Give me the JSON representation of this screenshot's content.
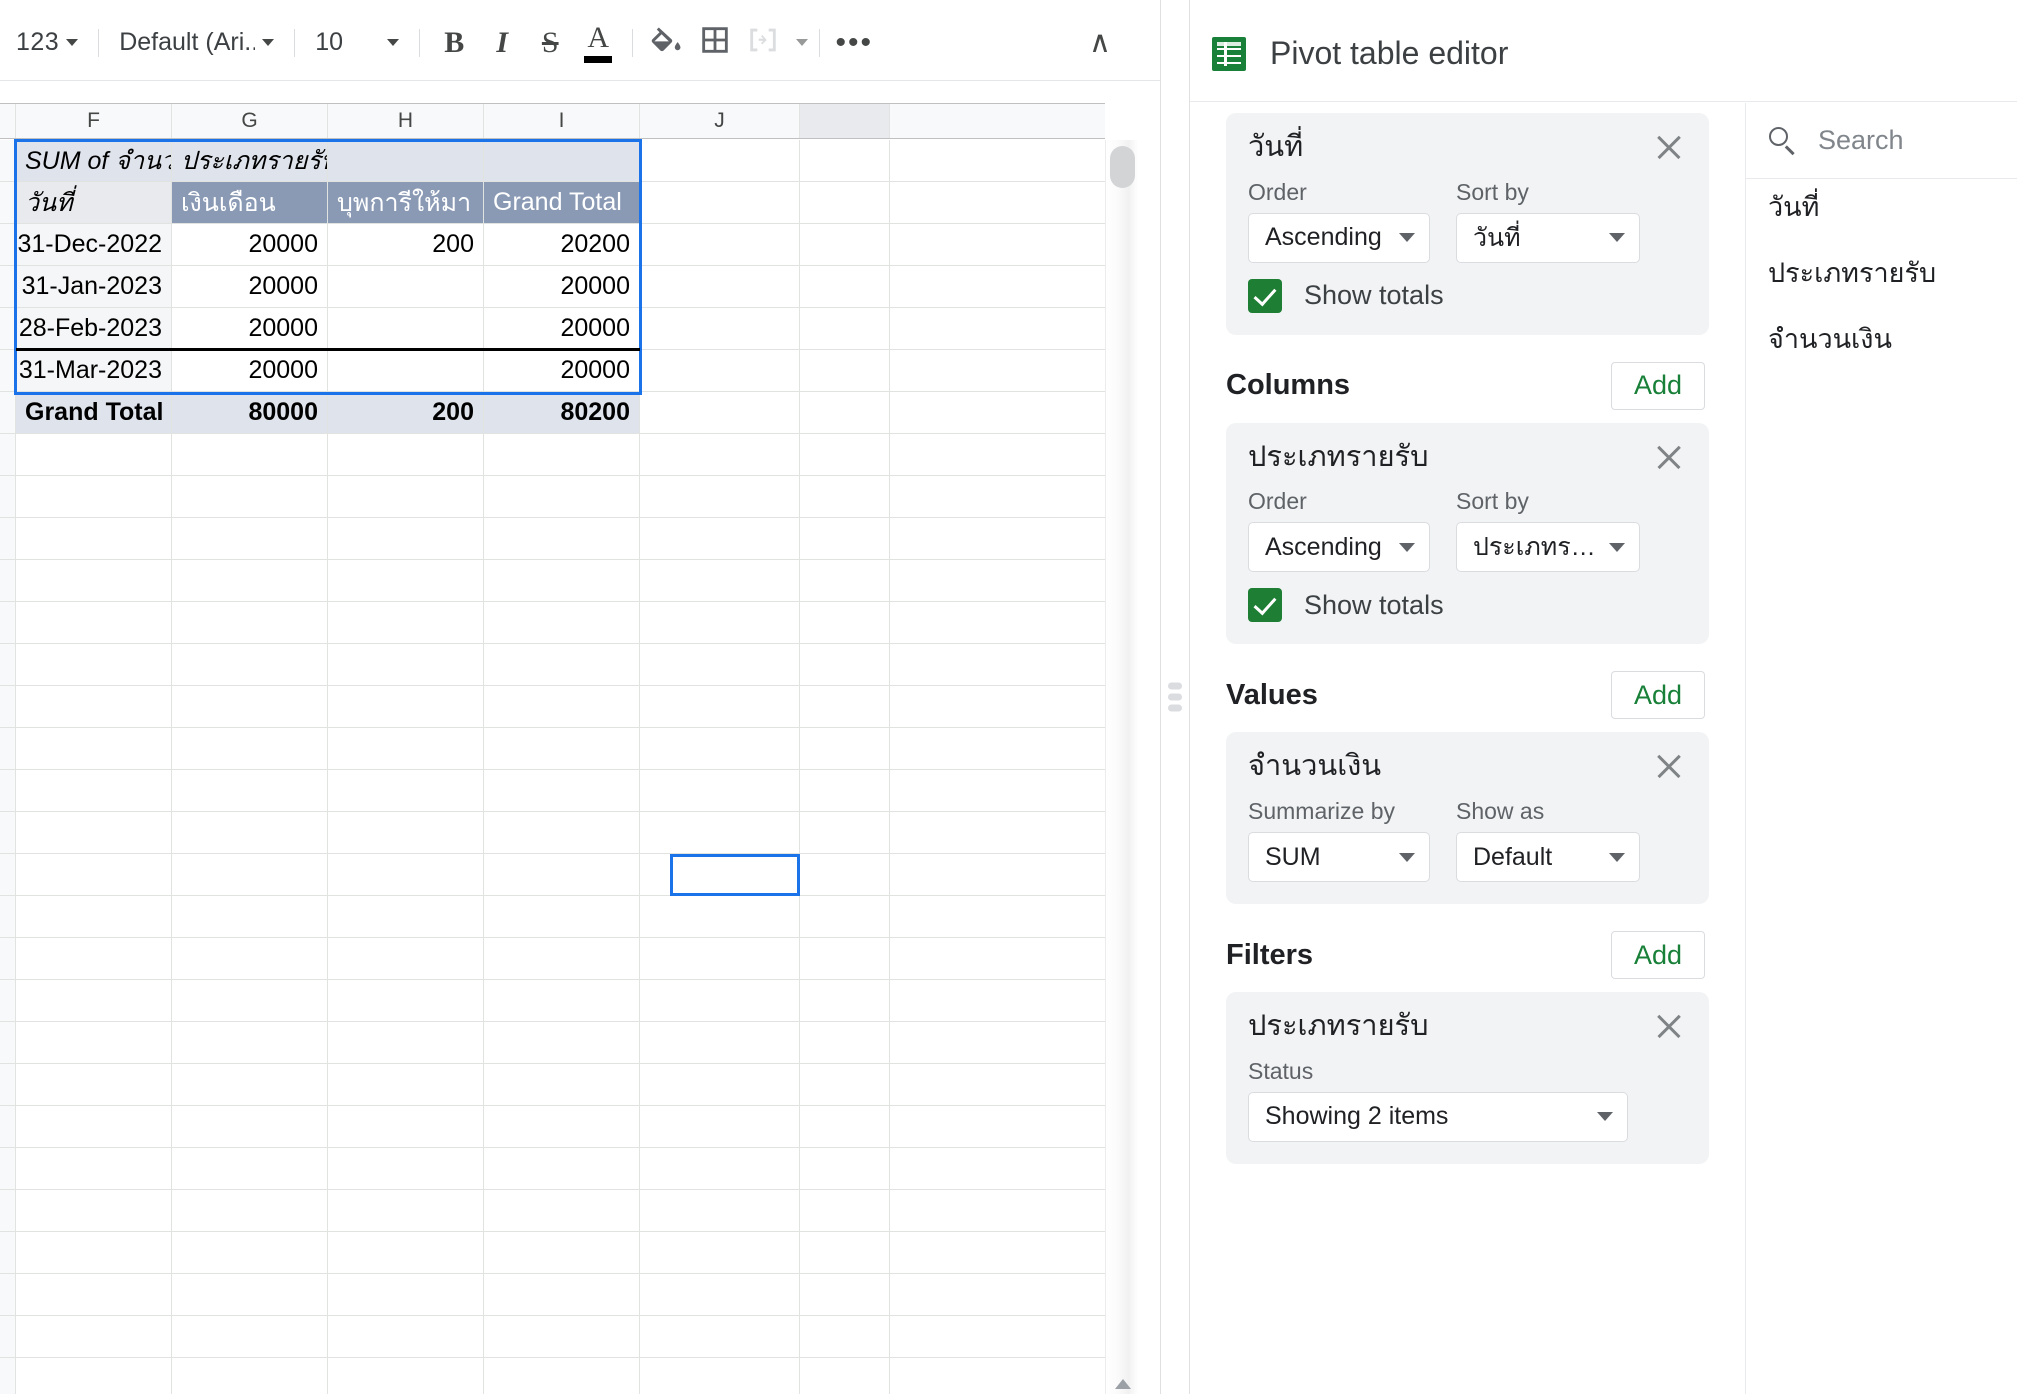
{
  "toolbar": {
    "number_format": "123",
    "font_name": "Default (Ari...",
    "font_size": "10",
    "bold": "B",
    "italic": "I",
    "strikethrough": "S",
    "text_color": "A",
    "more": "•••",
    "collapse": "∧"
  },
  "sheet": {
    "column_headers": [
      "F",
      "G",
      "H",
      "I",
      "J",
      ""
    ],
    "pivot": {
      "title_cell": "SUM of จำนวนเงิ",
      "column_field_cell": "ประเภทรายรับ",
      "row_header": "วันที่",
      "col_headers": [
        "เงินเดือน",
        "บุพการีให้มา",
        "Grand Total"
      ],
      "rows": [
        {
          "label": "31-Dec-2022",
          "values": [
            "20000",
            "200",
            "20200"
          ]
        },
        {
          "label": "31-Jan-2023",
          "values": [
            "20000",
            "",
            "20000"
          ]
        },
        {
          "label": "28-Feb-2023",
          "values": [
            "20000",
            "",
            "20000"
          ]
        },
        {
          "label": "31-Mar-2023",
          "values": [
            "20000",
            "",
            "20000"
          ]
        }
      ],
      "grand_total": {
        "label": "Grand Total",
        "values": [
          "80000",
          "200",
          "80200"
        ]
      }
    }
  },
  "editor": {
    "title": "Pivot table editor",
    "rows_section": {
      "card": {
        "name": "วันที่",
        "order_label": "Order",
        "order_value": "Ascending",
        "sortby_label": "Sort by",
        "sortby_value": "วันที่",
        "show_totals_label": "Show totals"
      }
    },
    "columns_section": {
      "title": "Columns",
      "add_label": "Add",
      "card": {
        "name": "ประเภทรายรับ",
        "order_label": "Order",
        "order_value": "Ascending",
        "sortby_label": "Sort by",
        "sortby_value": "ประเภทรา...",
        "show_totals_label": "Show totals"
      }
    },
    "values_section": {
      "title": "Values",
      "add_label": "Add",
      "card": {
        "name": "จำนวนเงิน",
        "summarize_label": "Summarize by",
        "summarize_value": "SUM",
        "showas_label": "Show as",
        "showas_value": "Default"
      }
    },
    "filters_section": {
      "title": "Filters",
      "add_label": "Add",
      "card": {
        "name": "ประเภทรายรับ",
        "status_label": "Status",
        "status_value": "Showing 2 items"
      }
    },
    "field_list": {
      "search_placeholder": "Search",
      "search_value": "",
      "items": [
        "วันที่",
        "ประเภทรายรับ",
        "จำนวนเงิน"
      ]
    }
  },
  "colors": {
    "accent_green": "#188038",
    "selection_blue": "#1a73e8",
    "pivot_header_fill": "#8a9ab5",
    "pivot_total_fill": "#dfe3eb"
  }
}
